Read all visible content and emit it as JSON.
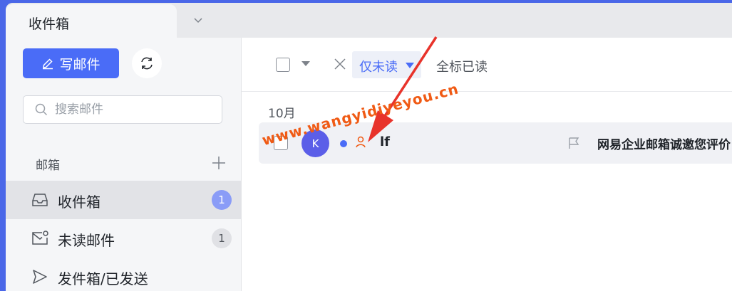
{
  "tabs": {
    "active_label": "收件箱"
  },
  "sidebar": {
    "compose_label": "写邮件",
    "search_placeholder": "搜索邮件",
    "section_title": "邮箱",
    "items": [
      {
        "label": "收件箱",
        "icon": "inbox-icon",
        "badge": "1",
        "active": true
      },
      {
        "label": "未读邮件",
        "icon": "unread-mail-icon",
        "badge": "1",
        "active": false
      },
      {
        "label": "发件箱/已发送",
        "icon": "send-icon",
        "badge": "",
        "active": false
      }
    ]
  },
  "toolbar": {
    "filter_label": "仅未读",
    "mark_all_label": "全标已读"
  },
  "mail_list": {
    "month": "10月",
    "messages": [
      {
        "avatar_letter": "K",
        "sender": "lf",
        "subject": "网易企业邮箱诚邀您评价",
        "unread": true
      }
    ]
  },
  "watermark": "www.wangyidiyeyou.cn",
  "colors": {
    "accent": "#4a6cf7",
    "brand_background": "#4a67e8",
    "annotation": "#e8332b",
    "watermark": "#f05a14"
  }
}
